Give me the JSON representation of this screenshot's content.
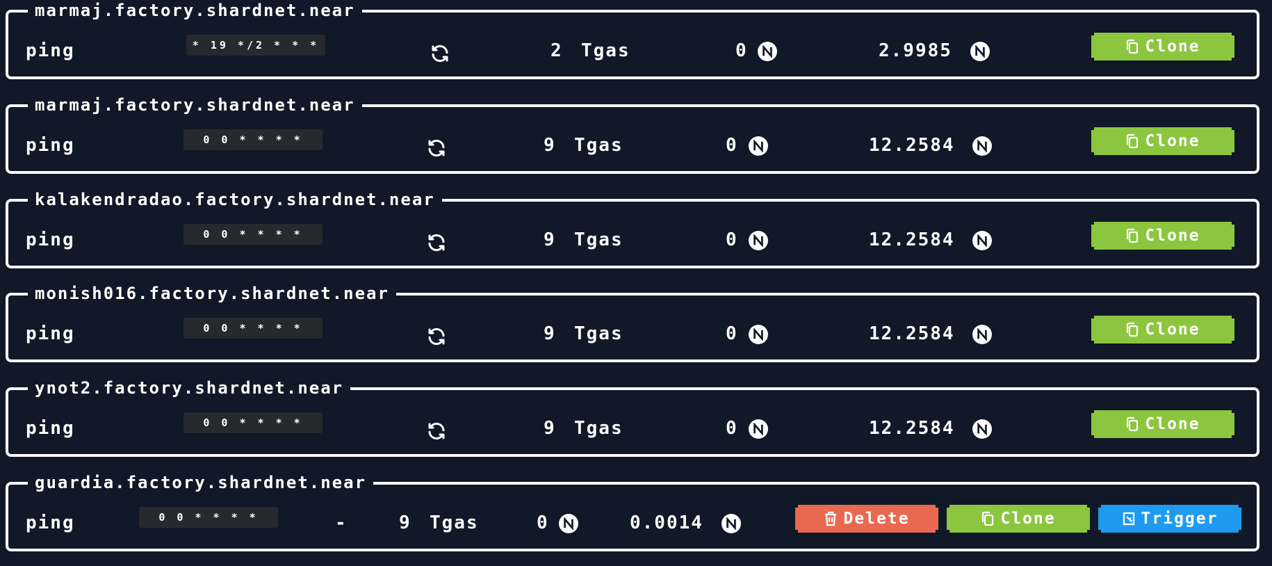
{
  "colors": {
    "background": "#111827",
    "clone": "#8cc63f",
    "delete": "#e8694f",
    "trigger": "#1e9bf0"
  },
  "tasks": [
    {
      "owner": "marmaj.factory.shardnet.near",
      "method": "ping",
      "cadence": "* 19 */2 * * *",
      "recurring_icon": "refresh-icon",
      "gas_value": "2",
      "gas_unit": "Tgas",
      "deposit": "0",
      "balance": "2.9985",
      "clone_label": "Clone"
    },
    {
      "owner": "marmaj.factory.shardnet.near",
      "method": "ping",
      "cadence": "0 0 * * * *",
      "recurring_icon": "refresh-icon",
      "gas_value": "9",
      "gas_unit": "Tgas",
      "deposit": "0",
      "balance": "12.2584",
      "clone_label": "Clone"
    },
    {
      "owner": "kalakendradao.factory.shardnet.near",
      "method": "ping",
      "cadence": "0 0 * * * *",
      "recurring_icon": "refresh-icon",
      "gas_value": "9",
      "gas_unit": "Tgas",
      "deposit": "0",
      "balance": "12.2584",
      "clone_label": "Clone"
    },
    {
      "owner": "monish016.factory.shardnet.near",
      "method": "ping",
      "cadence": "0 0 * * * *",
      "recurring_icon": "refresh-icon",
      "gas_value": "9",
      "gas_unit": "Tgas",
      "deposit": "0",
      "balance": "12.2584",
      "clone_label": "Clone"
    },
    {
      "owner": "ynot2.factory.shardnet.near",
      "method": "ping",
      "cadence": "0 0 * * * *",
      "recurring_icon": "refresh-icon",
      "gas_value": "9",
      "gas_unit": "Tgas",
      "deposit": "0",
      "balance": "12.2584",
      "clone_label": "Clone"
    },
    {
      "owner": "guardia.factory.shardnet.near",
      "method": "ping",
      "cadence": "0 0 * * * *",
      "recurring_text": "-",
      "gas_value": "9",
      "gas_unit": "Tgas",
      "deposit": "0",
      "balance": "0.0014",
      "delete_label": "Delete",
      "clone_label": "Clone",
      "trigger_label": "Trigger"
    }
  ]
}
